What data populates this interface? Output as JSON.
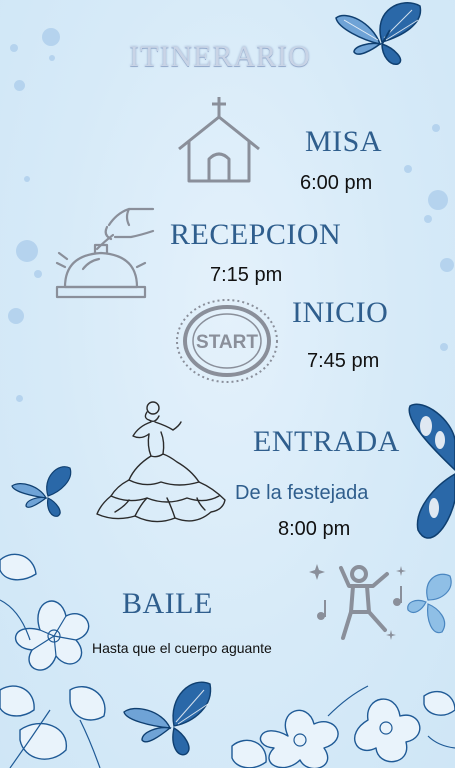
{
  "title": "ITINERARIO",
  "events": {
    "misa": {
      "label": "MISA",
      "time": "6:00 pm",
      "icon": "church-icon"
    },
    "recepcion": {
      "label": "RECEPCION",
      "time": "7:15 pm",
      "icon": "service-bell-icon"
    },
    "inicio": {
      "label": "INICIO",
      "time": "7:45 pm",
      "icon": "start-stamp-icon",
      "stamp_text": "START"
    },
    "entrada": {
      "label": "ENTRADA",
      "subtitle": "De la festejada",
      "time": "8:00 pm",
      "icon": "dancer-dress-icon"
    },
    "baile": {
      "label": "BAILE",
      "note": "Hasta que el cuerpo aguante",
      "icon": "dancing-person-icon"
    }
  },
  "decorations": [
    "butterfly-icon",
    "flower-icon",
    "music-note-icon",
    "sparkle-icon"
  ],
  "colors": {
    "background": "#d6eaf8",
    "accent": "#2f5e8d",
    "butterfly": "#1f5a96",
    "icon_gray": "#8a8f9a",
    "dots": "#b5d3ee"
  }
}
